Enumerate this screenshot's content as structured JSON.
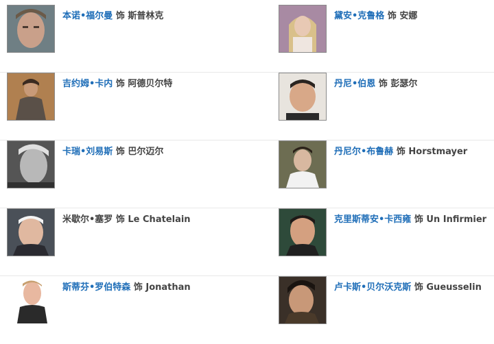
{
  "separator": "饰",
  "cast": [
    {
      "left": {
        "actor": "本诺•福尔曼",
        "role": "斯普林克",
        "linked": true
      },
      "right": {
        "actor": "黛安•克鲁格",
        "role": "安娜",
        "linked": true
      }
    },
    {
      "left": {
        "actor": "吉约姆•卡内",
        "role": "阿德贝尔特",
        "linked": true
      },
      "right": {
        "actor": "丹尼•伯恩",
        "role": "彭瑟尔",
        "linked": true
      }
    },
    {
      "left": {
        "actor": "卡瑞•刘易斯",
        "role": "巴尔迈尔",
        "linked": true
      },
      "right": {
        "actor": "丹尼尔•布鲁赫",
        "role": "Horstmayer",
        "linked": true
      }
    },
    {
      "left": {
        "actor": "米歇尔•塞罗",
        "role": "Le Chatelain",
        "linked": false
      },
      "right": {
        "actor": "克里斯蒂安•卡西雍",
        "role": "Un Infirmier",
        "linked": true
      }
    },
    {
      "left": {
        "actor": "斯蒂芬•罗伯特森",
        "role": "Jonathan",
        "linked": true
      },
      "right": {
        "actor": "卢卡斯•贝尔沃克斯",
        "role": "Gueusselin",
        "linked": true
      }
    }
  ],
  "colors": {
    "link": "#1f6eb8",
    "text": "#444444",
    "divider": "#e8e8e8"
  },
  "icons": {
    "photo": "portrait-photo"
  }
}
